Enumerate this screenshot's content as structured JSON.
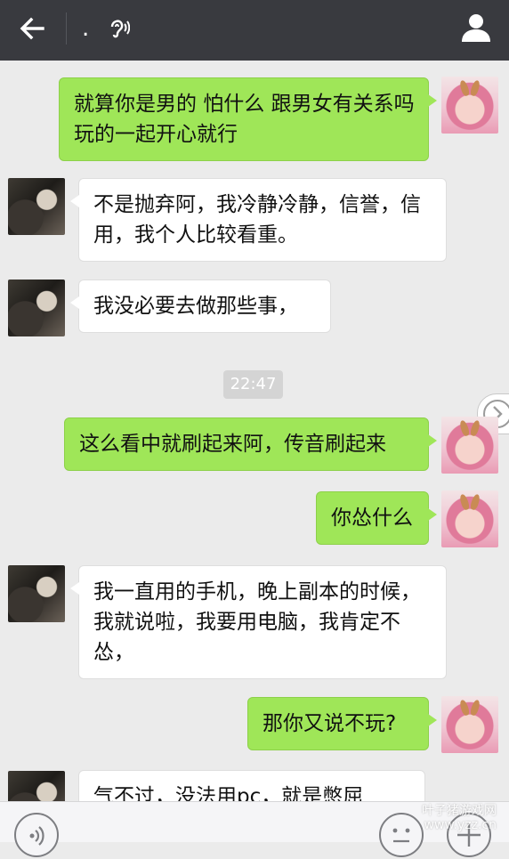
{
  "header": {
    "title": ".",
    "back_icon": "arrow-left-icon",
    "ear_icon": "ear-icon",
    "profile_icon": "person-icon"
  },
  "timestamp": "22:47",
  "messages": [
    {
      "sender": "me",
      "text": "就算你是男的 怕什么 跟男女有关系吗 玩的一起开心就行"
    },
    {
      "sender": "other",
      "text": "  不是抛弃阿，我冷静冷静，信誉，信用，我个人比较看重。"
    },
    {
      "sender": "other",
      "text": "我没必要去做那些事，"
    },
    {
      "sender": "me",
      "text": "这么看中就刷起来阿，传音刷起来"
    },
    {
      "sender": "me",
      "text": "你怂什么"
    },
    {
      "sender": "other",
      "text": "我一直用的手机，晚上副本的时候，我就说啦，我要用电脑，我肯定不怂，"
    },
    {
      "sender": "me",
      "text": "那你又说不玩?"
    },
    {
      "sender": "other",
      "text": "气不过，没法用pc，就是憋屈"
    }
  ],
  "bottom_bar": {
    "voice_icon": "voice-icon",
    "emoji_icon": "emoji-icon",
    "plus_icon": "plus-icon"
  },
  "watermark": {
    "line1": "叶子猪游戏网",
    "line2": "www.yzz.cn"
  },
  "colors": {
    "topbar": "#393a3f",
    "background": "#ebebeb",
    "me_bubble": "#9fe658",
    "other_bubble": "#ffffff"
  }
}
